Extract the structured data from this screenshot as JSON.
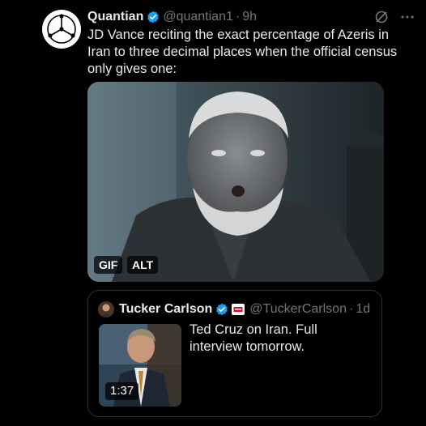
{
  "tweet": {
    "author_name": "Quantian",
    "handle": "@quantian1",
    "separator": "·",
    "time": "9h",
    "text": "JD Vance reciting the exact percentage of Azeris in Iran to three decimal places when the official census only gives one:",
    "media_badges": {
      "gif": "GIF",
      "alt": "ALT"
    }
  },
  "quoted_tweet": {
    "author_name": "Tucker Carlson",
    "handle": "@TuckerCarlson",
    "separator": "·",
    "time": "1d",
    "text": "Ted Cruz on Iran. Full interview tomorrow.",
    "video_duration": "1:37"
  },
  "icons": {
    "verified": "verified-badge-icon",
    "grok": "grok-icon",
    "more": "more-icon",
    "affiliate": "affiliate-badge-icon"
  },
  "colors": {
    "background": "#000000",
    "text": "#e7e9ea",
    "secondary": "#71767b",
    "verified": "#1d9bf0",
    "border": "#2f3336"
  }
}
